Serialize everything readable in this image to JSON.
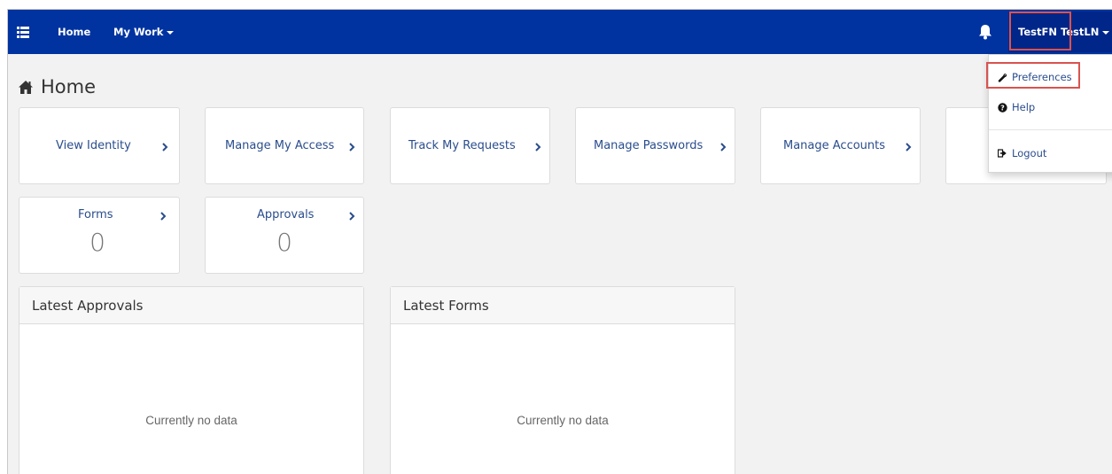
{
  "navbar": {
    "home_label": "Home",
    "mywork_label": "My Work",
    "user_label": "TestFN TestLN",
    "bg_color": "#0033a0"
  },
  "page": {
    "title": "Home"
  },
  "tiles_row1": [
    {
      "label": "View Identity"
    },
    {
      "label": "Manage My Access"
    },
    {
      "label": "Track My Requests"
    },
    {
      "label": "Manage Passwords"
    },
    {
      "label": "Manage Accounts"
    }
  ],
  "tiles_row2": [
    {
      "label": "Forms",
      "count": "0"
    },
    {
      "label": "Approvals",
      "count": "0"
    }
  ],
  "panels": [
    {
      "title": "Latest Approvals",
      "empty": "Currently no data"
    },
    {
      "title": "Latest Forms",
      "empty": "Currently no data"
    }
  ],
  "user_dropdown": {
    "items": [
      {
        "label": "Preferences",
        "icon": "wrench-icon"
      },
      {
        "label": "Help",
        "icon": "question-circle-icon"
      },
      {
        "label": "Logout",
        "icon": "logout-icon"
      }
    ]
  },
  "colors": {
    "accent": "#0033a0",
    "link": "#2a4d8c",
    "highlight": "#d9534f"
  }
}
